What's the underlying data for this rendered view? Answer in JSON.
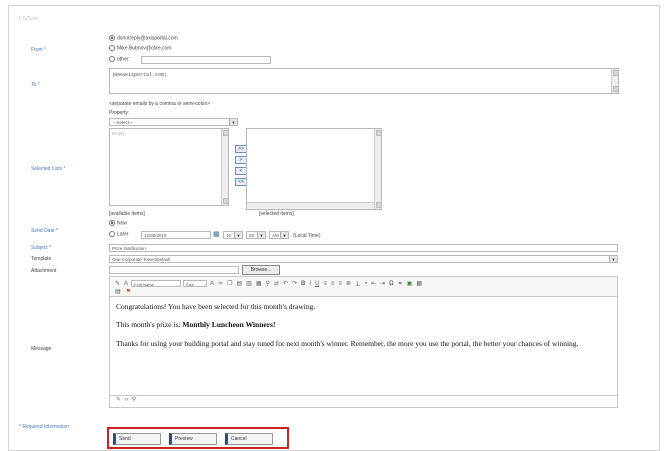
{
  "breadcrumb": "US/Suite",
  "labels": {
    "from": "From *",
    "to": "To *",
    "selected_lists": "Selected Lists *",
    "send_date": "Send Date *",
    "subject": "Subject *",
    "template": "Template",
    "attachment": "Attachment",
    "message": "Message",
    "required_info": "* Required Information"
  },
  "from": {
    "options": [
      "donotreply@axisportal.com",
      "Mike.Bubnov@cbre.com",
      "other:"
    ],
    "selected_index": 0,
    "other_value": ""
  },
  "to": {
    "value": "peeaxisportal.com;",
    "hint": "<separate emails by a comma or semi-colon>"
  },
  "lists": {
    "property_label": "Property:",
    "property_value": "---Select---",
    "available_placeholder": "Empty",
    "available_caption": "[available items]",
    "selected_caption": "[selected items]",
    "move_buttons": [
      ">>",
      ">",
      "<",
      "<<"
    ]
  },
  "send_date": {
    "now_label": "Now",
    "later_label": "Later",
    "date_value": "12/30/2019",
    "hour_value": "10",
    "minute_value": "20",
    "ampm_value": "AM",
    "tz_label": "(Local Time)"
  },
  "subject_value": "Prize Notification",
  "template_value": "One Corporate Tower/Default",
  "attachment_button": "Browse...",
  "editor": {
    "font_name": "Font Name",
    "font_size": "Size",
    "line1": "Congratulations! You have been selected for this month's drawing.",
    "line2_prefix": "This month's prize is: ",
    "line2_bold": "Monthly Luncheon Winners!",
    "line3": "Thanks for using your building portal and stay tuned for next month's winner. Remember, the more you use the portal, the better your chances of winning."
  },
  "actions": {
    "send": "Send",
    "preview": "Preview",
    "cancel": "Cancel"
  },
  "colors": {
    "label_blue": "#4a78b8",
    "highlight_red": "#cc2222",
    "button_accent": "#2c4d82"
  }
}
